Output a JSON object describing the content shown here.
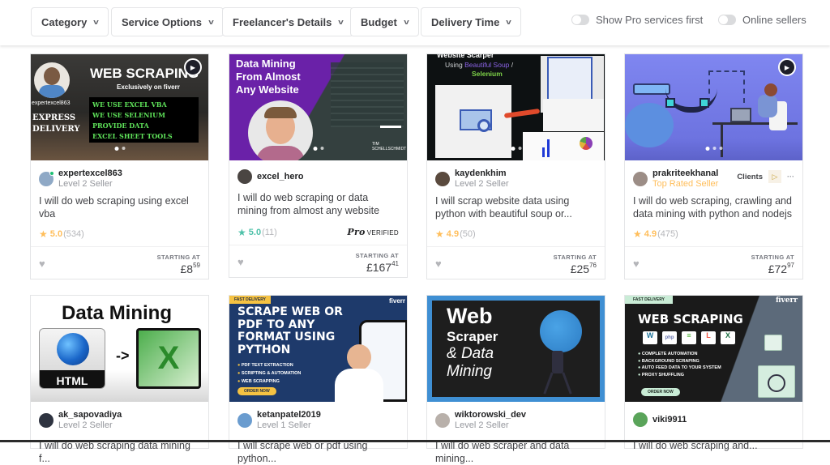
{
  "filters": {
    "dropdowns": [
      {
        "label": "Category"
      },
      {
        "label": "Service Options"
      },
      {
        "label": "Freelancer's Details"
      },
      {
        "label": "Budget"
      },
      {
        "label": "Delivery Time"
      }
    ],
    "toggles": [
      {
        "label": "Show Pro services first",
        "on": false
      },
      {
        "label": "Online sellers",
        "on": false
      }
    ]
  },
  "colors": {
    "star_gold": "#ffbe5b",
    "star_pro": "#4ec1a9",
    "online": "#1dbf73",
    "top_rated": "#ffbe5b"
  },
  "gigs": [
    {
      "thumb": {
        "heading": "WEB SCRAPING",
        "sub": "Exclusively on fiverr",
        "side_handle": "expertexcel863",
        "side_text": "EXPRESS DELIVERY",
        "bullets": [
          "WE USE EXCEL VBA",
          "WE USE SELENIUM",
          "PROVIDE DATA",
          "EXCEL SHEET TOOLS"
        ],
        "has_video": true
      },
      "seller": "expertexcel863",
      "level": "Level 2 Seller",
      "online": true,
      "title": "I will do web scraping using excel vba",
      "rating": "5.0",
      "reviews": "(534)",
      "starting_label": "STARTING AT",
      "price_main": "£8",
      "price_cents": "59"
    },
    {
      "thumb": {
        "heading_lines": [
          "Data Mining",
          "From Almost",
          "Any Website"
        ],
        "brand": "TIM SCHELLSCHMIDT"
      },
      "seller": "excel_hero",
      "level": "",
      "title": "I will do web scraping or data mining from almost any website",
      "rating": "5.0",
      "reviews": "(11)",
      "pro_badge": "VERIFIED",
      "pro_word": "Pro",
      "starting_label": "STARTING AT",
      "price_main": "£167",
      "price_cents": "41"
    },
    {
      "thumb": {
        "heading": "Website Scarper",
        "line2_prefix": "Using",
        "line2_a": "Beautiful Soup",
        "line2_b": "Selenium"
      },
      "seller": "kaydenkhim",
      "level": "Level 2 Seller",
      "title": "I will scrap website data using python with beautiful soup or...",
      "rating": "4.9",
      "reviews": "(50)",
      "starting_label": "STARTING AT",
      "price_main": "£25",
      "price_cents": "76"
    },
    {
      "thumb": {
        "has_video": true
      },
      "seller": "prakriteekhanal",
      "level": "Top Rated Seller",
      "clients_label": "Clients",
      "title": "I will do web scraping, crawling and data mining with python and nodejs",
      "rating": "4.9",
      "reviews": "(475)",
      "starting_label": "STARTING AT",
      "price_main": "£72",
      "price_cents": "97"
    },
    {
      "thumb": {
        "heading": "Data Mining",
        "left_label": "HTML",
        "arrow": "->"
      },
      "seller": "ak_sapovadiya",
      "level": "Level 2 Seller",
      "title": "I will do web scraping data mining f..."
    },
    {
      "thumb": {
        "badge": "FAST DELIVERY",
        "brand": "fiverr",
        "heading_lines": [
          "SCRAPE WEB OR",
          "PDF TO ANY",
          "FORMAT USING",
          "PYTHON"
        ],
        "bullets": [
          "PDF TEXT EXTRACTION",
          "SCRIPTING & AUTOMATION",
          "WEB SCRAPPING"
        ],
        "cta": "ORDER NOW"
      },
      "seller": "ketanpatel2019",
      "level": "Level 1 Seller",
      "title": "I will scrape web or pdf using python..."
    },
    {
      "thumb": {
        "heading_lines": [
          "Web",
          "Scraper",
          "& Data",
          "Mining"
        ]
      },
      "seller": "wiktorowski_dev",
      "level": "Level 2 Seller",
      "title": "I will do web scraper and data mining..."
    },
    {
      "thumb": {
        "badge": "FAST DELIVERY",
        "brand": "fiverr",
        "heading": "WEB SCRAPING",
        "bullets": [
          "COMPLETE AUTOMATION",
          "BACKGROUND SCRAPING",
          "AUTO FEED DATA TO YOUR SYSTEM",
          "PROXY SHUFFLING"
        ],
        "cta": "ORDER NOW"
      },
      "seller": "viki9911",
      "level": "",
      "title": "I will do web scraping and..."
    }
  ]
}
